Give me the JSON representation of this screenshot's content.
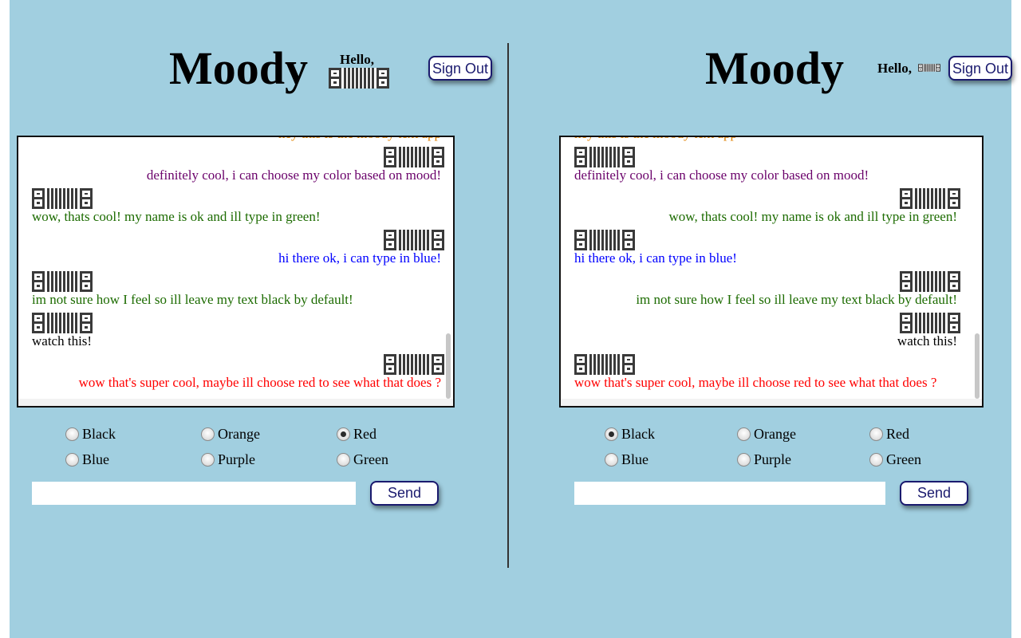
{
  "colors": {
    "background": "#a1cfe0",
    "black": "#000000",
    "orange": "#e08000",
    "red": "#ff0000",
    "blue": "#0000ff",
    "purple": "#6a006a",
    "green": "#1c6b00",
    "button_text": "#1a1a6e"
  },
  "left": {
    "title": "Moody",
    "hello": "Hello,",
    "sign_out": "Sign Out",
    "avatar_icon": "qr-identicon",
    "messages": [
      {
        "text": "hey this is the moody text app",
        "color": "orange",
        "align": "right",
        "icon": false
      },
      {
        "text": "definitely cool, i can choose my color based on mood!",
        "color": "purple",
        "align": "right",
        "icon": true
      },
      {
        "text": "wow, thats cool! my name is ok and ill type in green!",
        "color": "green",
        "align": "left",
        "icon": true
      },
      {
        "text": "hi there ok, i can type in blue!",
        "color": "blue",
        "align": "right",
        "icon": true
      },
      {
        "text": "im not sure how I feel so ill leave my text black by default!",
        "color": "green",
        "align": "left",
        "icon": true
      },
      {
        "text": "watch this!",
        "color": "black",
        "align": "left",
        "icon": true
      },
      {
        "text": "wow that's super cool, maybe ill choose red to see what that does ?",
        "color": "red",
        "align": "right",
        "icon": true
      }
    ],
    "radios": [
      {
        "label": "Black",
        "checked": false
      },
      {
        "label": "Orange",
        "checked": false
      },
      {
        "label": "Red",
        "checked": true
      },
      {
        "label": "Blue",
        "checked": false
      },
      {
        "label": "Purple",
        "checked": false
      },
      {
        "label": "Green",
        "checked": false
      }
    ],
    "input_value": "",
    "send": "Send"
  },
  "right": {
    "title": "Moody",
    "hello": "Hello,",
    "sign_out": "Sign Out",
    "avatar_icon": "qr-identicon",
    "messages": [
      {
        "text": "hey this is the moody text app",
        "color": "orange",
        "align": "left",
        "icon": false
      },
      {
        "text": "definitely cool, i can choose my color based on mood!",
        "color": "purple",
        "align": "left",
        "icon": true
      },
      {
        "text": "wow, thats cool! my name is ok and ill type in green!",
        "color": "green",
        "align": "right",
        "icon": true
      },
      {
        "text": "hi there ok, i can type in blue!",
        "color": "blue",
        "align": "left",
        "icon": true
      },
      {
        "text": "im not sure how I feel so ill leave my text black by default!",
        "color": "green",
        "align": "right",
        "icon": true
      },
      {
        "text": "watch this!",
        "color": "black",
        "align": "right",
        "icon": true
      },
      {
        "text": "wow that's super cool, maybe ill choose red to see what that does ?",
        "color": "red",
        "align": "left",
        "icon": true
      }
    ],
    "radios": [
      {
        "label": "Black",
        "checked": true
      },
      {
        "label": "Orange",
        "checked": false
      },
      {
        "label": "Red",
        "checked": false
      },
      {
        "label": "Blue",
        "checked": false
      },
      {
        "label": "Purple",
        "checked": false
      },
      {
        "label": "Green",
        "checked": false
      }
    ],
    "input_value": "",
    "send": "Send"
  }
}
